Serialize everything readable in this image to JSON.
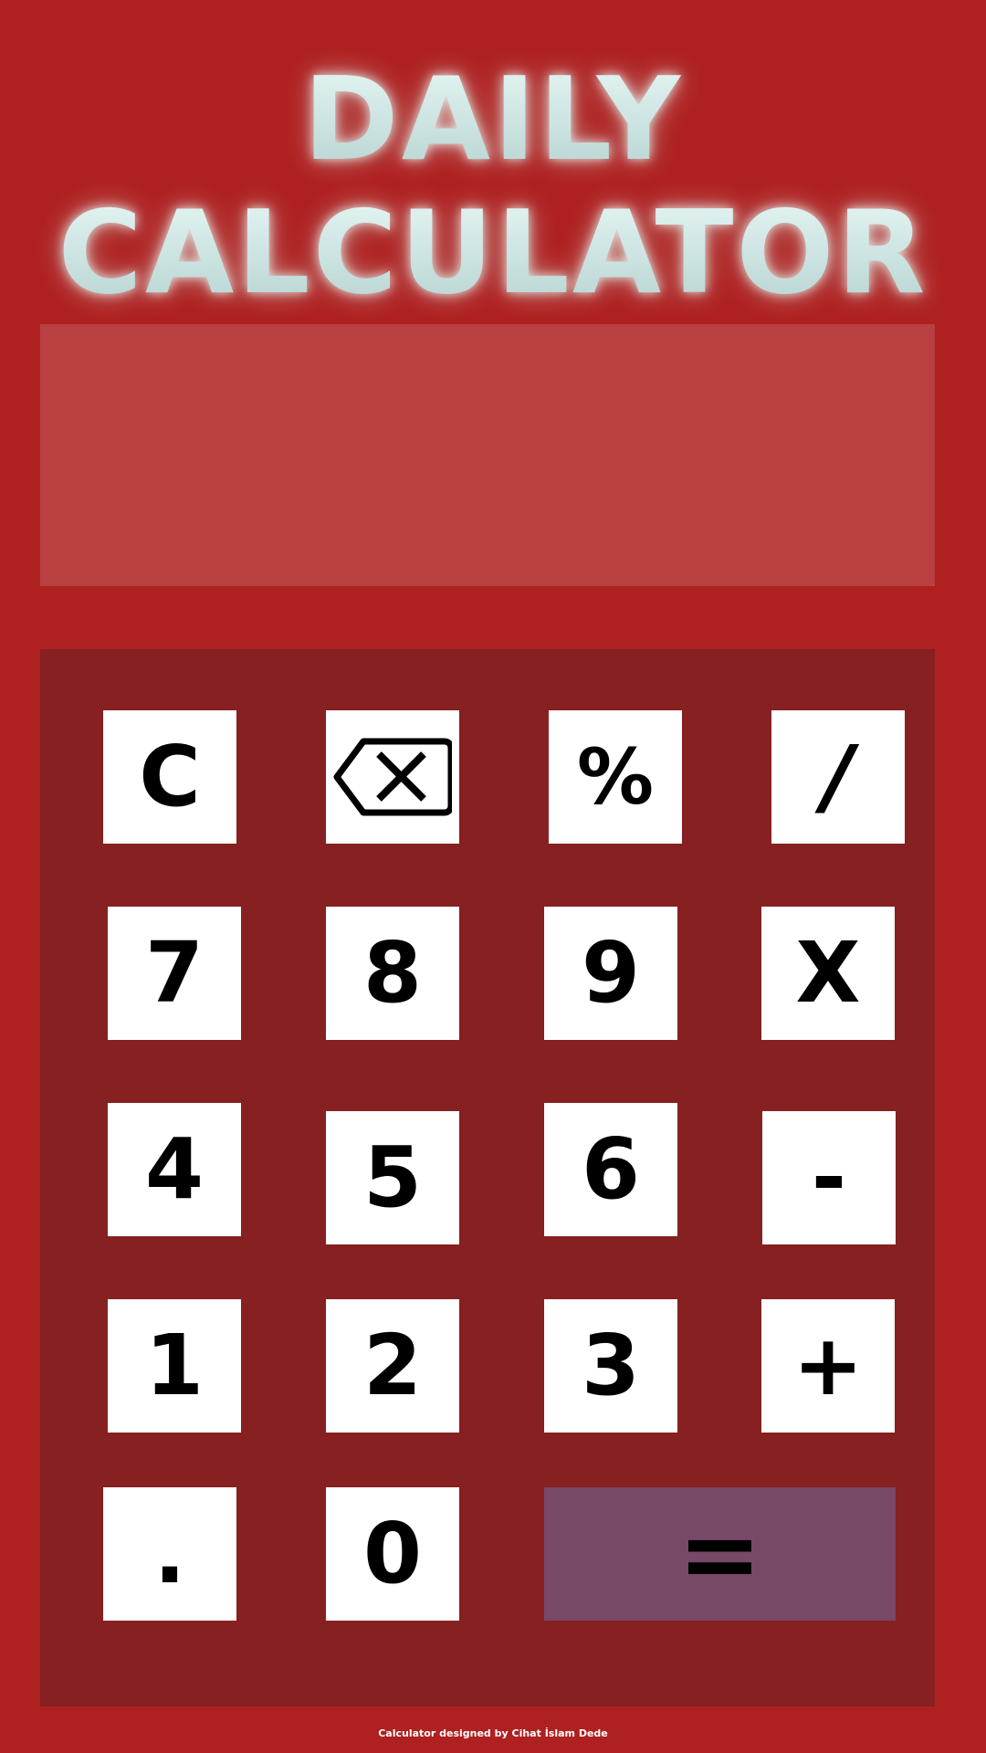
{
  "header": {
    "title_line1": "DAILY",
    "title_line2": "CALCULATOR"
  },
  "display": {
    "value": ""
  },
  "keys": {
    "clear": "C",
    "backspace_icon": "backspace-icon",
    "percent": "%",
    "divide": "/",
    "seven": "7",
    "eight": "8",
    "nine": "9",
    "multiply": "X",
    "four": "4",
    "five": "5",
    "six": "6",
    "minus": "-",
    "one": "1",
    "two": "2",
    "three": "3",
    "plus": "+",
    "decimal": ".",
    "zero": "0",
    "equals": "="
  },
  "footer": {
    "credit": "Calculator designed by Cihat İslam Dede"
  },
  "colors": {
    "background": "#af2020",
    "display": "#b94040",
    "keypad": "#862021",
    "key": "#ffffff",
    "equals_key": "#784867",
    "title_glow": "#c9e6e4"
  }
}
